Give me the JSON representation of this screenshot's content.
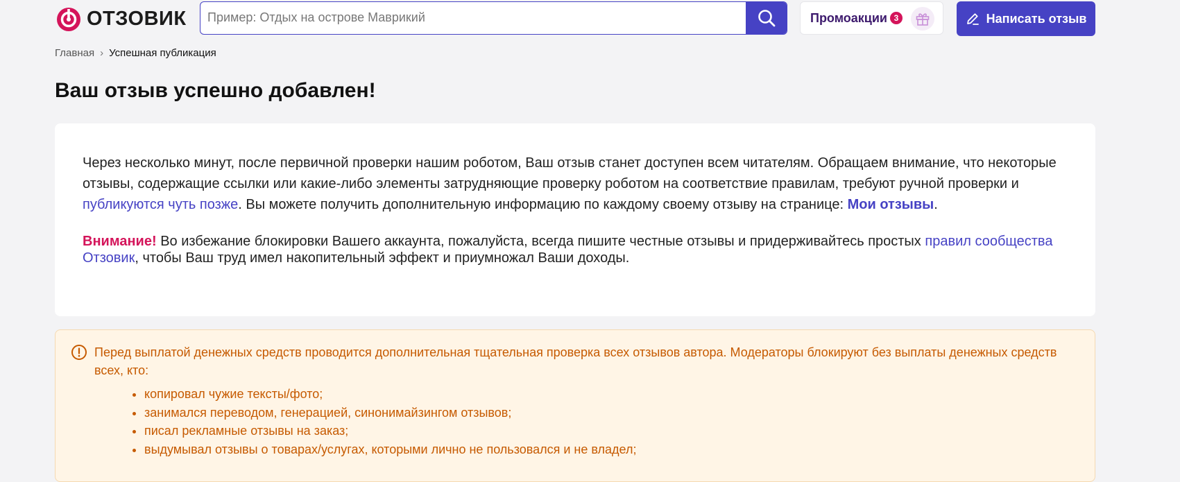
{
  "header": {
    "logo_text": "ОТЗОВИК",
    "search_placeholder": "Пример: Отдых на острове Маврикий",
    "promo_label": "Промоакции",
    "promo_count": "3",
    "write_button_label": "Написать отзыв"
  },
  "breadcrumb": {
    "home": "Главная",
    "separator": "›",
    "current": "Успешная публикация"
  },
  "page_title": "Ваш отзыв успешно добавлен!",
  "info_card": {
    "p1_text1": "Через несколько минут, после первичной проверки нашим роботом, Ваш отзыв станет доступен всем читателям. Обращаем внимание, что некоторые отзывы, содержащие ссылки или какие-либо элементы затрудняющие проверку роботом на соответствие правилам, требуют ручной проверки и ",
    "p1_link1": "публикуются чуть позже",
    "p1_text2": ". Вы можете получить дополнительную информацию по каждому своему отзыву на странице: ",
    "p1_link2": "Мои отзывы",
    "p1_text3": ".",
    "p2_warning": "Внимание!",
    "p2_text1": " Во избежание блокировки Вашего аккаунта, пожалуйста, всегда пишите честные отзывы и придерживайтесь простых ",
    "p2_link": "правил сообщества Отзовик",
    "p2_text2": ", чтобы Ваш труд имел накопительный эффект и приумножал Ваши доходы."
  },
  "notice": {
    "text": "Перед выплатой денежных средств проводится дополнительная тщательная проверка всех отзывов автора. Модераторы блокируют без выплаты денежных средств всех, кто:",
    "items": [
      "копировал чужие тексты/фото;",
      "занимался переводом, генерацией, синонимайзингом отзывов;",
      "писал рекламные отзывы на заказ;",
      "выдумывал отзывы о товарах/услугах, которыми лично не пользовался и не владел;"
    ]
  },
  "colors": {
    "brand": "#d4145a",
    "accent": "#4642c4",
    "notice_text": "#c65a00",
    "notice_bg": "#fff5e6"
  }
}
